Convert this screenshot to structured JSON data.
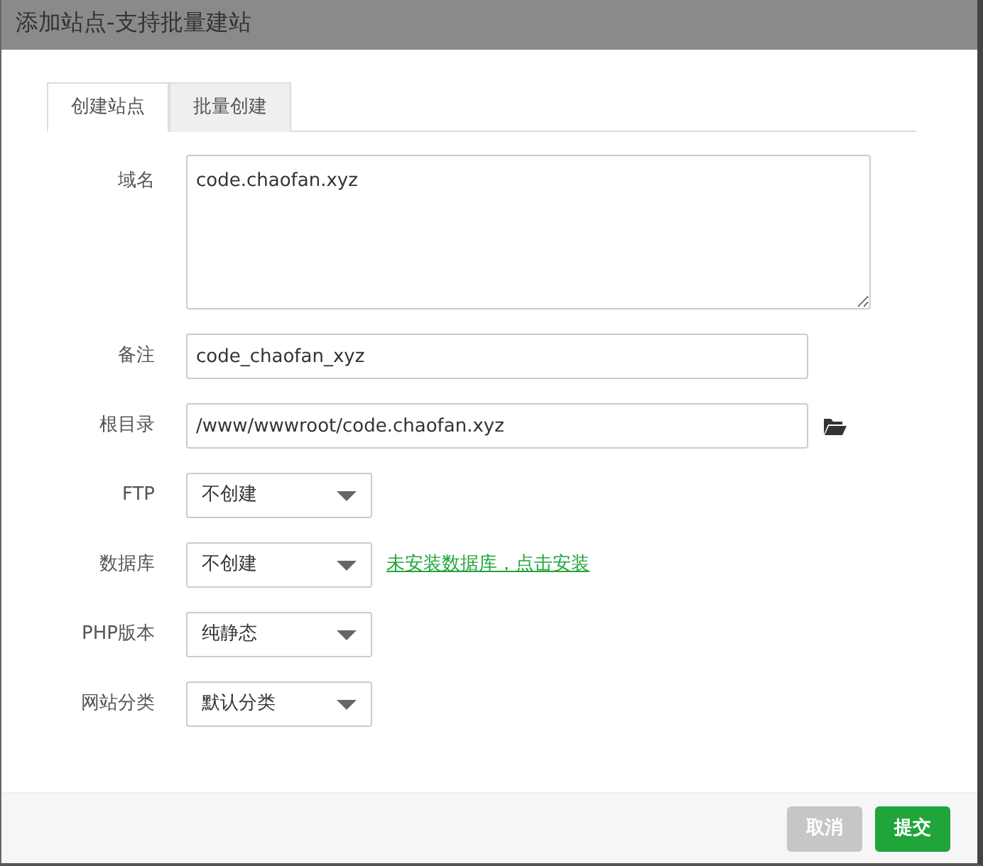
{
  "window": {
    "title": "添加站点-支持批量建站"
  },
  "tabs": [
    {
      "label": "创建站点",
      "selected": true
    },
    {
      "label": "批量创建",
      "selected": false
    }
  ],
  "fields": [
    {
      "kind": "textarea",
      "label": "域名",
      "value": "code.chaofan.xyz"
    },
    {
      "kind": "text",
      "label": "备注",
      "value": "code_chaofan_xyz"
    },
    {
      "kind": "path",
      "label": "根目录",
      "value": "/www/wwwroot/code.chaofan.xyz"
    },
    {
      "kind": "select",
      "label": "FTP",
      "value": "不创建"
    },
    {
      "kind": "select",
      "label": "数据库",
      "value": "不创建",
      "note": "未安装数据库，点击安装"
    },
    {
      "kind": "select",
      "label": "PHP版本",
      "value": "纯静态"
    },
    {
      "kind": "select",
      "label": "网站分类",
      "value": "默认分类"
    }
  ],
  "buttons": [
    {
      "label": "取消",
      "kind": "cancel"
    },
    {
      "label": "提交",
      "kind": "submit"
    }
  ]
}
